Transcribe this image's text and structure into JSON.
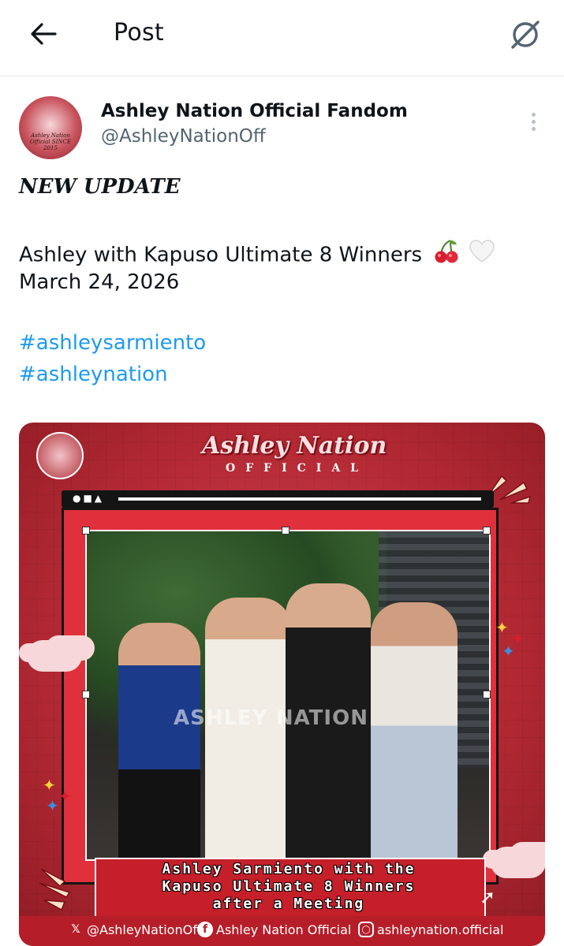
{
  "header": {
    "title": "Post",
    "back_icon": "arrow-left-icon",
    "grok_icon": "grok-icon"
  },
  "author": {
    "name": "Ashley Nation Official Fandom",
    "handle": "@AshleyNationOff",
    "avatar_text": "Ashley Nation Official SINCE 2015"
  },
  "post": {
    "headline": "NEW UPDATE",
    "line1": "Ashley with Kapuso Ultimate 8 Winners",
    "line1_emoji": [
      "cherries",
      "white-heart"
    ],
    "line2": "March 24, 2026",
    "hashtags": [
      "#ashleysarmiento",
      "#ashleynation"
    ]
  },
  "media": {
    "logo_text": "Ashley Nation Official SINCE 2015",
    "brand": "Ashley Nation",
    "brand_sub": "OFFICIAL",
    "watermark": "ASHLEY NATION",
    "caption_lines": [
      "Ashley Sarmiento with the",
      "Kapuso Ultimate 8 Winners",
      "after a Meeting"
    ],
    "socials": [
      {
        "icon": "x-logo-icon",
        "text": "@AshleyNationOff"
      },
      {
        "icon": "facebook-icon",
        "text": "Ashley Nation Official"
      },
      {
        "icon": "instagram-icon",
        "text": "ashleynation.official"
      }
    ]
  },
  "colors": {
    "link": "#1d9bf0",
    "secondary": "#536471",
    "frame_red": "#e0303c"
  }
}
